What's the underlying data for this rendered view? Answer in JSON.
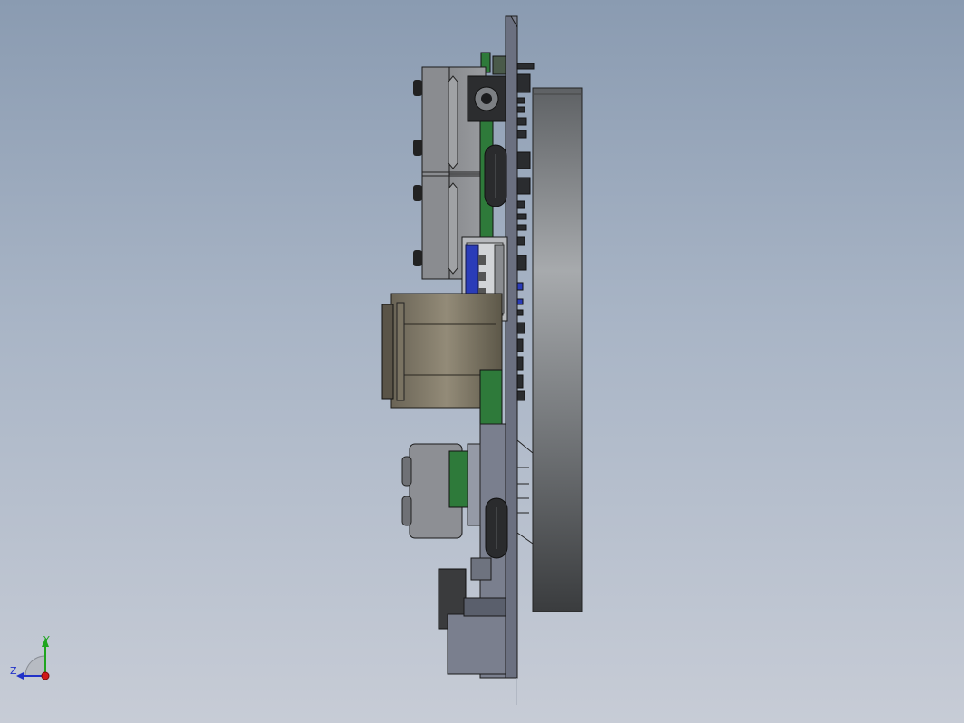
{
  "viewport": {
    "background_top": "#8a9bb1",
    "background_bottom": "#c7ccd6"
  },
  "triad": {
    "y_label": "Y",
    "z_label": "Z",
    "y_color": "#1fa51f",
    "z_color": "#2232c8",
    "x_color": "#d01818"
  },
  "model": {
    "pcb_color": "#7a7f8e",
    "heatsink_color": "#4a4d50",
    "usb_insulator_color": "#2a3cb8",
    "green_board_color": "#2e7a3a"
  }
}
